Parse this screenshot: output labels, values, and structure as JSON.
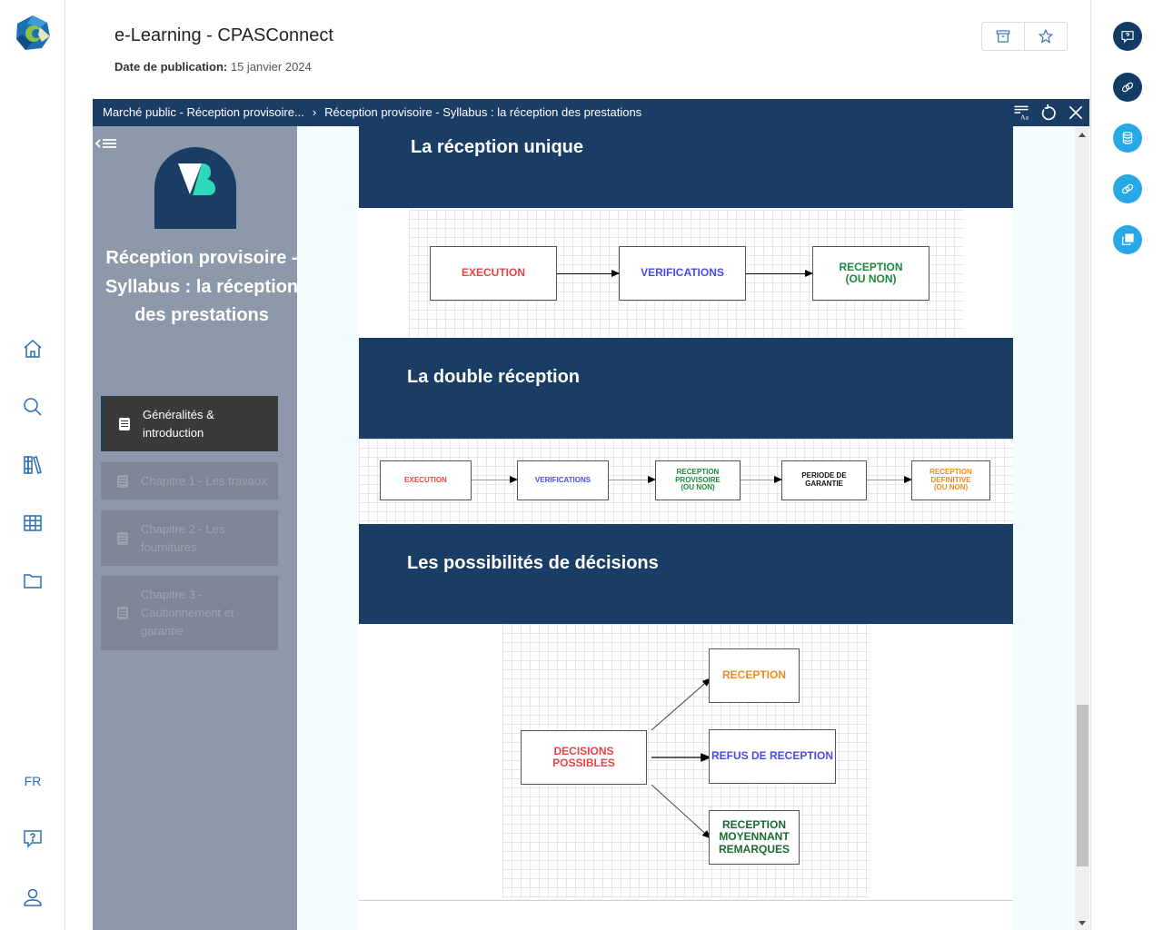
{
  "app": {
    "title": "e-Learning - CPASConnect",
    "pub_label": "Date de publication:",
    "pub_date": "15 janvier 2024"
  },
  "left_nav": {
    "items": [
      {
        "name": "home-icon",
        "label": "Accueil"
      },
      {
        "name": "search-icon",
        "label": "Recherche"
      },
      {
        "name": "library-icon",
        "label": "Bibliothèque"
      },
      {
        "name": "grid-icon",
        "label": "Catalogue"
      },
      {
        "name": "folder-icon",
        "label": "Dossiers"
      }
    ],
    "language": "FR",
    "bottom_items": [
      {
        "name": "help-chat-icon"
      },
      {
        "name": "user-icon"
      }
    ]
  },
  "header_buttons": [
    {
      "name": "archive-icon"
    },
    {
      "name": "star-icon"
    }
  ],
  "right_rail": [
    {
      "name": "help-chat-icon",
      "color": "#0f3d66"
    },
    {
      "name": "link-icon",
      "color": "#0f3d66"
    },
    {
      "name": "database-icon",
      "color": "#29a8e8"
    },
    {
      "name": "link-icon",
      "color": "#29a8e8"
    },
    {
      "name": "copy-icon",
      "color": "#29a8e8"
    }
  ],
  "viewer": {
    "breadcrumb": [
      "Marché public - Réception provisoire...",
      "Réception provisoire - Syllabus : la réception des prestations"
    ],
    "breadcrumb_sep": "›",
    "tools": [
      "text-settings-icon",
      "refresh-icon",
      "close-icon"
    ]
  },
  "course": {
    "title": "Réception provisoire - Syllabus : la réception des prestations",
    "chapters": [
      {
        "label": "Généralités & introduction",
        "state": "active"
      },
      {
        "label": "Chapitre 1 - Les travaux",
        "state": "locked"
      },
      {
        "label": "Chapitre 2 - Les fournitures",
        "state": "locked"
      },
      {
        "label": "Chapitre 3 - Cautionnement et garantie",
        "state": "locked"
      }
    ]
  },
  "sections": [
    {
      "heading": "La réception unique",
      "diagram": {
        "boxes": [
          {
            "label": "EXECUTION",
            "color": "#e84444"
          },
          {
            "label": "VERIFICATIONS",
            "color": "#4a4ae8"
          },
          {
            "label": "RECEPTION\n(OU NON)",
            "color": "#1a8a3a"
          }
        ]
      }
    },
    {
      "heading": "La double réception",
      "diagram": {
        "boxes": [
          {
            "label": "EXECUTION",
            "color": "#e84444"
          },
          {
            "label": "VERIFICATIONS",
            "color": "#4a4ae8"
          },
          {
            "label": "RECEPTION\nPROVISOIRE\n(OU NON)",
            "color": "#1a8a3a"
          },
          {
            "label": "PERIODE DE\nGARANTIE",
            "color": "#111111"
          },
          {
            "label": "RECEPTION\nDEFINITIVE\n(OU NON)",
            "color": "#f08a20"
          }
        ]
      }
    },
    {
      "heading": "Les possibilités de décisions",
      "diagram": {
        "source": {
          "label": "DECISIONS\nPOSSIBLES",
          "color": "#e84444"
        },
        "targets": [
          {
            "label": "RECEPTION",
            "color": "#f08a20"
          },
          {
            "label": "REFUS DE RECEPTION",
            "color": "#4a4ae8"
          },
          {
            "label": "RECEPTION\nMOYENNANT\nREMARQUES",
            "color": "#1a6a30"
          }
        ]
      }
    }
  ]
}
